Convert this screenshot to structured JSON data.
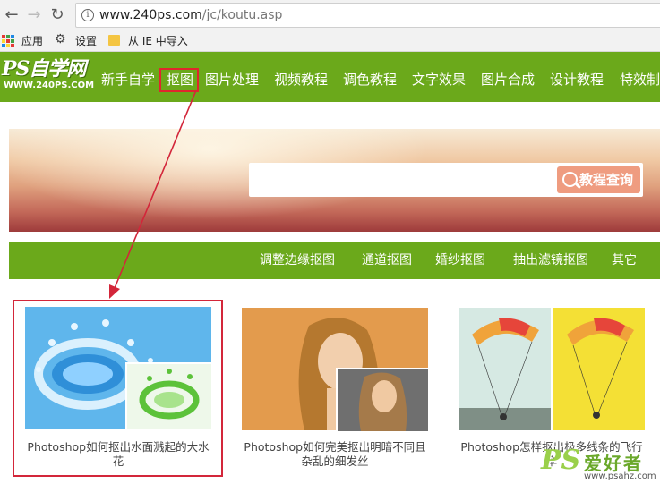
{
  "browser": {
    "back_icon": "back-arrow-icon",
    "forward_icon": "forward-arrow-icon",
    "reload_icon": "reload-icon",
    "url_host": "www.240ps.com",
    "url_path": "/jc/koutu.asp"
  },
  "bookmarks": [
    {
      "label": "应用",
      "icon": "apps-grid-icon"
    },
    {
      "label": "设置",
      "icon": "gear-icon"
    },
    {
      "label": "从 IE 中导入",
      "icon": "folder-icon"
    }
  ],
  "site": {
    "logo_text": "PS自学网",
    "logo_url": "WWW.240PS.COM",
    "nav": [
      "新手自学",
      "抠图",
      "图片处理",
      "视频教程",
      "调色教程",
      "文字效果",
      "图片合成",
      "设计教程",
      "特效制作"
    ],
    "active_nav": "抠图",
    "search_button": "教程查询",
    "search_placeholder": "",
    "subnav": [
      "调整边缘抠图",
      "通道抠图",
      "婚纱抠图",
      "抽出滤镜抠图",
      "其它"
    ]
  },
  "articles": [
    {
      "caption": "Photoshop如何抠出水面溅起的大水花"
    },
    {
      "caption": "Photoshop如何完美抠出明暗不同且杂乱的细发丝"
    },
    {
      "caption": "Photoshop怎样抠出极多线条的飞行伞"
    }
  ],
  "watermark": {
    "ps": "PS",
    "cn": "爱好者",
    "url": "www.psahz.com"
  },
  "colors": {
    "accent_green": "#6ba91b",
    "highlight_red": "#d3263a"
  }
}
